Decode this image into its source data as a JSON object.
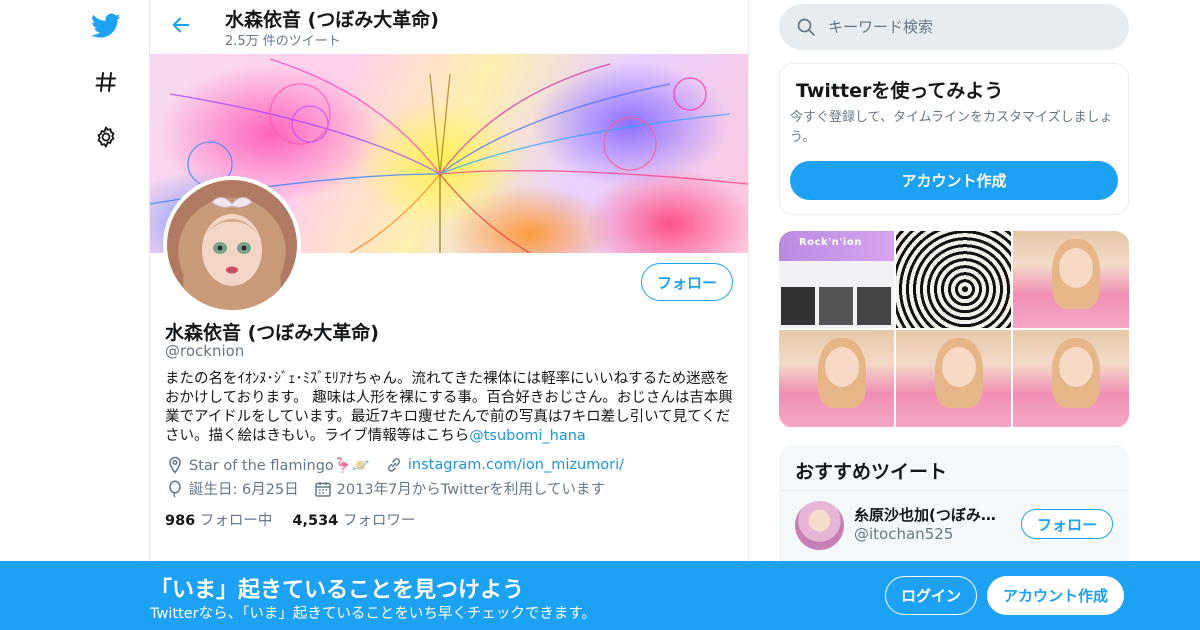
{
  "colors": {
    "accent": "#1da1f2",
    "link": "#1b95e0",
    "muted": "#657786",
    "border": "#e6ecf0"
  },
  "nav": {
    "items": [
      {
        "icon": "twitter-bird-icon"
      },
      {
        "icon": "hashtag-explore-icon"
      },
      {
        "icon": "gear-icon"
      }
    ]
  },
  "header": {
    "title": "水森依音 (つぼみ大革命)",
    "subtitle": "2.5万 件のツイート",
    "back_icon": "arrow-left-icon"
  },
  "profile": {
    "follow_label": "フォロー",
    "name": "水森依音 (つぼみ大革命)",
    "handle": "@rocknion",
    "bio_text": "またの名をｲｵﾝﾇ･ｼﾞｪ･ﾐｽﾞﾓﾘｱﾅちゃん。流れてきた裸体には軽率にいいねするため迷惑をおかけしております。 趣味は人形を裸にする事。百合好きおじさん。おじさんは吉本興業でアイドルをしています。最近7キロ痩せたんで前の写真は7キロ差し引いて見てください。描く絵はきもい。ライブ情報等はこちら",
    "bio_link": "@tsubomi_hana",
    "location": "Star of the flamingo🦩🪐",
    "website": "instagram.com/ion_mizumori/",
    "birthday": "誕生日: 6月25日",
    "joined": "2013年7月からTwitterを利用しています",
    "following_count": "986",
    "following_label": "フォロー中",
    "followers_count": "4,534",
    "followers_label": "フォロワー"
  },
  "search": {
    "placeholder": "キーワード検索"
  },
  "signup_box": {
    "title": "Twitterを使ってみよう",
    "description": "今すぐ登録して、タイムラインをカスタマイズしましょう。",
    "button": "アカウント作成"
  },
  "media": {
    "tile1_text": "Rock'n'ion"
  },
  "recommended": {
    "title": "おすすめツイート",
    "user_name": "糸原沙也加(つぼみ大革命)",
    "user_handle": "@itochan525",
    "follow_label": "フォロー"
  },
  "bottom_bar": {
    "title": "「いま」起きていることを見つけよう",
    "subtitle": "Twitterなら、「いま」起きていることをいち早くチェックできます。",
    "login": "ログイン",
    "signup": "アカウント作成"
  }
}
